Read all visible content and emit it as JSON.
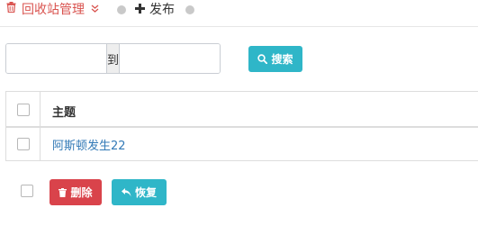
{
  "tabs": {
    "recycle_label": "回收站管理",
    "publish_label": "发布"
  },
  "filter": {
    "start_value": "",
    "range_separator": "到",
    "end_value": "",
    "search_label": "搜索"
  },
  "table": {
    "header_title": "主题",
    "rows": [
      {
        "title": "阿斯顿发生22"
      }
    ]
  },
  "actions": {
    "delete_label": "删除",
    "restore_label": "恢复"
  },
  "colors": {
    "danger": "#d9434b",
    "info": "#2fb6c8",
    "link": "#337ab7"
  }
}
